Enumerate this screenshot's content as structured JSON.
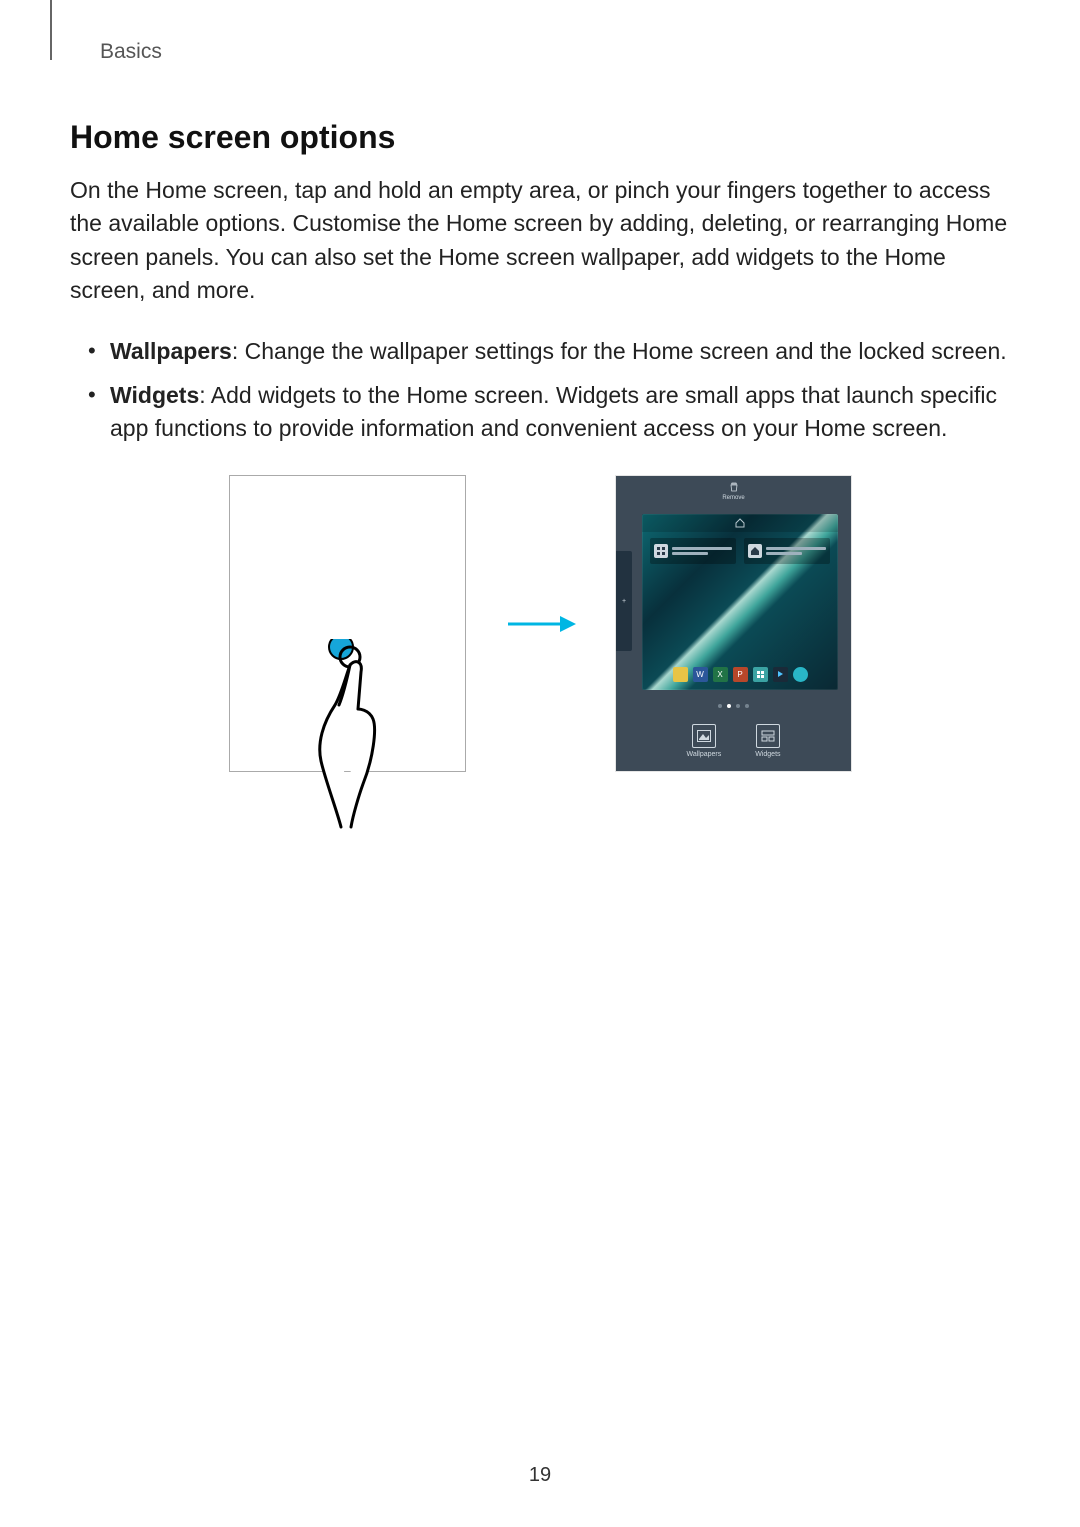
{
  "header": {
    "breadcrumb": "Basics"
  },
  "section": {
    "title": "Home screen options",
    "intro": "On the Home screen, tap and hold an empty area, or pinch your fingers together to access the available options. Customise the Home screen by adding, deleting, or rearranging Home screen panels. You can also set the Home screen wallpaper, add widgets to the Home screen, and more.",
    "bullets": [
      {
        "term": "Wallpapers",
        "desc": ": Change the wallpaper settings for the Home screen and the locked screen."
      },
      {
        "term": "Widgets",
        "desc": ": Add widgets to the Home screen. Widgets are small apps that launch specific app functions to provide information and convenient access on your Home screen."
      }
    ]
  },
  "figure": {
    "remove_label": "Remove",
    "bottom_buttons": [
      {
        "key": "wallpapers",
        "label": "Wallpapers"
      },
      {
        "key": "widgets",
        "label": "Widgets"
      }
    ],
    "arrow_color": "#00B6E3"
  },
  "page_number": "19"
}
